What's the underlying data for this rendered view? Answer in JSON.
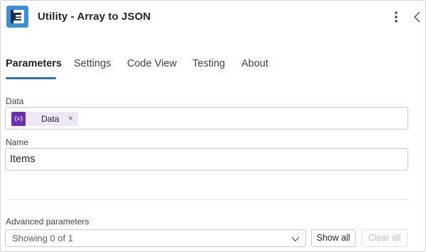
{
  "header": {
    "title": "Utility - Array to JSON",
    "logo_icon": "connector-logo-icon",
    "menu_icon": "more-vertical-icon",
    "collapse_icon": "chevron-left-icon"
  },
  "tabs": [
    {
      "label": "Parameters",
      "active": true
    },
    {
      "label": "Settings",
      "active": false
    },
    {
      "label": "Code View",
      "active": false
    },
    {
      "label": "Testing",
      "active": false
    },
    {
      "label": "About",
      "active": false
    }
  ],
  "fields": {
    "data": {
      "label": "Data",
      "token": {
        "label": "Data",
        "icon": "{x}",
        "remove": "×",
        "color": "#6a2fb0"
      }
    },
    "name": {
      "label": "Name",
      "value": "Items"
    }
  },
  "advanced": {
    "label": "Advanced parameters",
    "select_value": "Showing 0 of 1",
    "show_all": "Show all",
    "clear_all": "Clear all"
  },
  "colors": {
    "accent": "#2f6fb3",
    "logo": "#3b8fd6",
    "token_bg": "#efe7f7"
  }
}
